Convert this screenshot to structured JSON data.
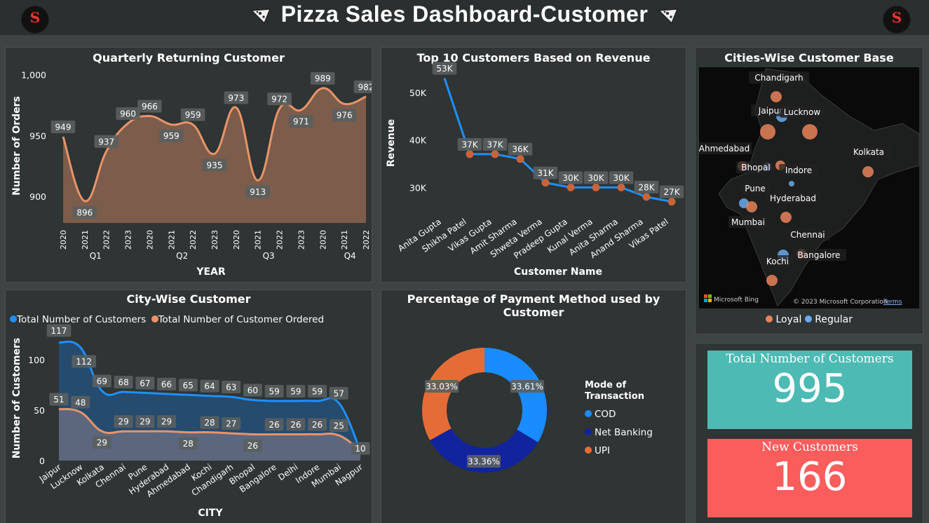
{
  "header": {
    "title": "Pizza Sales Dashboard-Customer",
    "logo_text": "S"
  },
  "panels": {
    "quarterly_title": "Quarterly Returning Customer",
    "top10_title": "Top 10 Customers Based on Revenue",
    "map_title": "Cities-Wise Customer Base",
    "city_title": "City-Wise Customer",
    "payment_title": "Percentage of Payment Method used by Customer"
  },
  "chart_data": [
    {
      "type": "area",
      "title": "Quarterly Returning Customer",
      "xlabel": "YEAR",
      "ylabel": "Number of Orders",
      "x": [
        "2020",
        "2021",
        "2022",
        "2023",
        "2020",
        "2021",
        "2022",
        "2023",
        "2020",
        "2021",
        "2022",
        "2023",
        "2020",
        "2021",
        "2022"
      ],
      "groups": [
        {
          "label": "Q1",
          "count": 4
        },
        {
          "label": "Q2",
          "count": 4
        },
        {
          "label": "Q3",
          "count": 4
        },
        {
          "label": "Q4",
          "count": 3
        }
      ],
      "values": [
        949,
        896,
        937,
        960,
        966,
        959,
        959,
        935,
        973,
        913,
        972,
        971,
        989,
        976,
        982
      ],
      "yticks": [
        "900",
        "950",
        "1,000"
      ],
      "ylim": [
        878,
        1005
      ],
      "color": "#e8946a"
    },
    {
      "type": "line",
      "title": "Top 10 Customers Based on Revenue",
      "xlabel": "Customer Name",
      "ylabel": "Revenue",
      "categories": [
        "Anita Gupta",
        "Shikha Patel",
        "Vikas Gupta",
        "Amit Sharma",
        "Shweta Verma",
        "Pradeep Gupta",
        "Kunal Verma",
        "Anita Sharma",
        "Anand Sharma",
        "Vikas Patel"
      ],
      "values": [
        53000,
        37000,
        37000,
        36000,
        31000,
        30000,
        30000,
        30000,
        28000,
        27000
      ],
      "labels": [
        "53K",
        "37K",
        "37K",
        "36K",
        "31K",
        "30K",
        "30K",
        "30K",
        "28K",
        "27K"
      ],
      "yticks": [
        "30K",
        "40K",
        "50K"
      ],
      "ylim": [
        24000,
        55000
      ],
      "color": "#1e90ff"
    },
    {
      "type": "area",
      "title": "City-Wise Customer",
      "xlabel": "CITY",
      "ylabel": "Number of Customers",
      "categories": [
        "Jaipur",
        "Lucknow",
        "Kolkata",
        "Chennai",
        "Pune",
        "Hyderabad",
        "Ahmedabad",
        "Kochi",
        "Chandigarh",
        "Bhopal",
        "Bangalore",
        "Delhi",
        "Indore",
        "Mumbai",
        "Nagpur"
      ],
      "series": [
        {
          "name": "Total Number of Customers",
          "values": [
            117,
            112,
            69,
            68,
            67,
            66,
            65,
            64,
            63,
            60,
            59,
            59,
            59,
            57,
            10
          ],
          "labels": [
            "117",
            "112",
            "69",
            "68",
            "67",
            "66",
            "65",
            "64",
            "63",
            "60",
            "59",
            "59",
            "59",
            "57",
            "10"
          ],
          "color": "#1e90ff"
        },
        {
          "name": "Total Number of Customer Ordered",
          "values": [
            51,
            48,
            29,
            29,
            29,
            29,
            28,
            28,
            27,
            26,
            26,
            26,
            26,
            25,
            10
          ],
          "labels": [
            "51",
            "48",
            "29",
            "29",
            "29",
            "29",
            "28",
            "28",
            "27",
            "26",
            "26",
            "26",
            "26",
            "25",
            ""
          ],
          "color": "#e8946a"
        }
      ],
      "yticks": [
        "0",
        "50",
        "100"
      ],
      "ylim": [
        0,
        120
      ]
    },
    {
      "type": "pie",
      "title": "Percentage of Payment Method used by Customer",
      "legend_title": "Mode of Transaction",
      "slices": [
        {
          "name": "COD",
          "value": 33.61,
          "label": "33.61%",
          "color": "#1a8cff"
        },
        {
          "name": "Net Banking",
          "value": 33.36,
          "label": "33.36%",
          "color": "#12239e"
        },
        {
          "name": "UPI",
          "value": 33.03,
          "label": "33.03%",
          "color": "#e66c37"
        }
      ]
    }
  ],
  "map": {
    "cities": [
      "Chandigarh",
      "Jaipur",
      "Lucknow",
      "Ahmedabad",
      "Bhopal",
      "Indore",
      "Kolkata",
      "Pune",
      "Hyderabad",
      "Mumbai",
      "Chennai",
      "Kochi",
      "Bangalore"
    ],
    "legend": [
      {
        "name": "Loyal",
        "color": "#e8835a"
      },
      {
        "name": "Regular",
        "color": "#6aaaf0"
      }
    ],
    "attribution_left": "Microsoft Bing",
    "attribution_right": "© 2023 Microsoft Corporation",
    "terms": "Terms"
  },
  "kpis": {
    "total_customers_label": "Total Number of Customers",
    "total_customers_value": "995",
    "total_color": "#4dbab4",
    "new_customers_label": "New Customers",
    "new_customers_value": "166",
    "new_color": "#fb5c5c"
  }
}
